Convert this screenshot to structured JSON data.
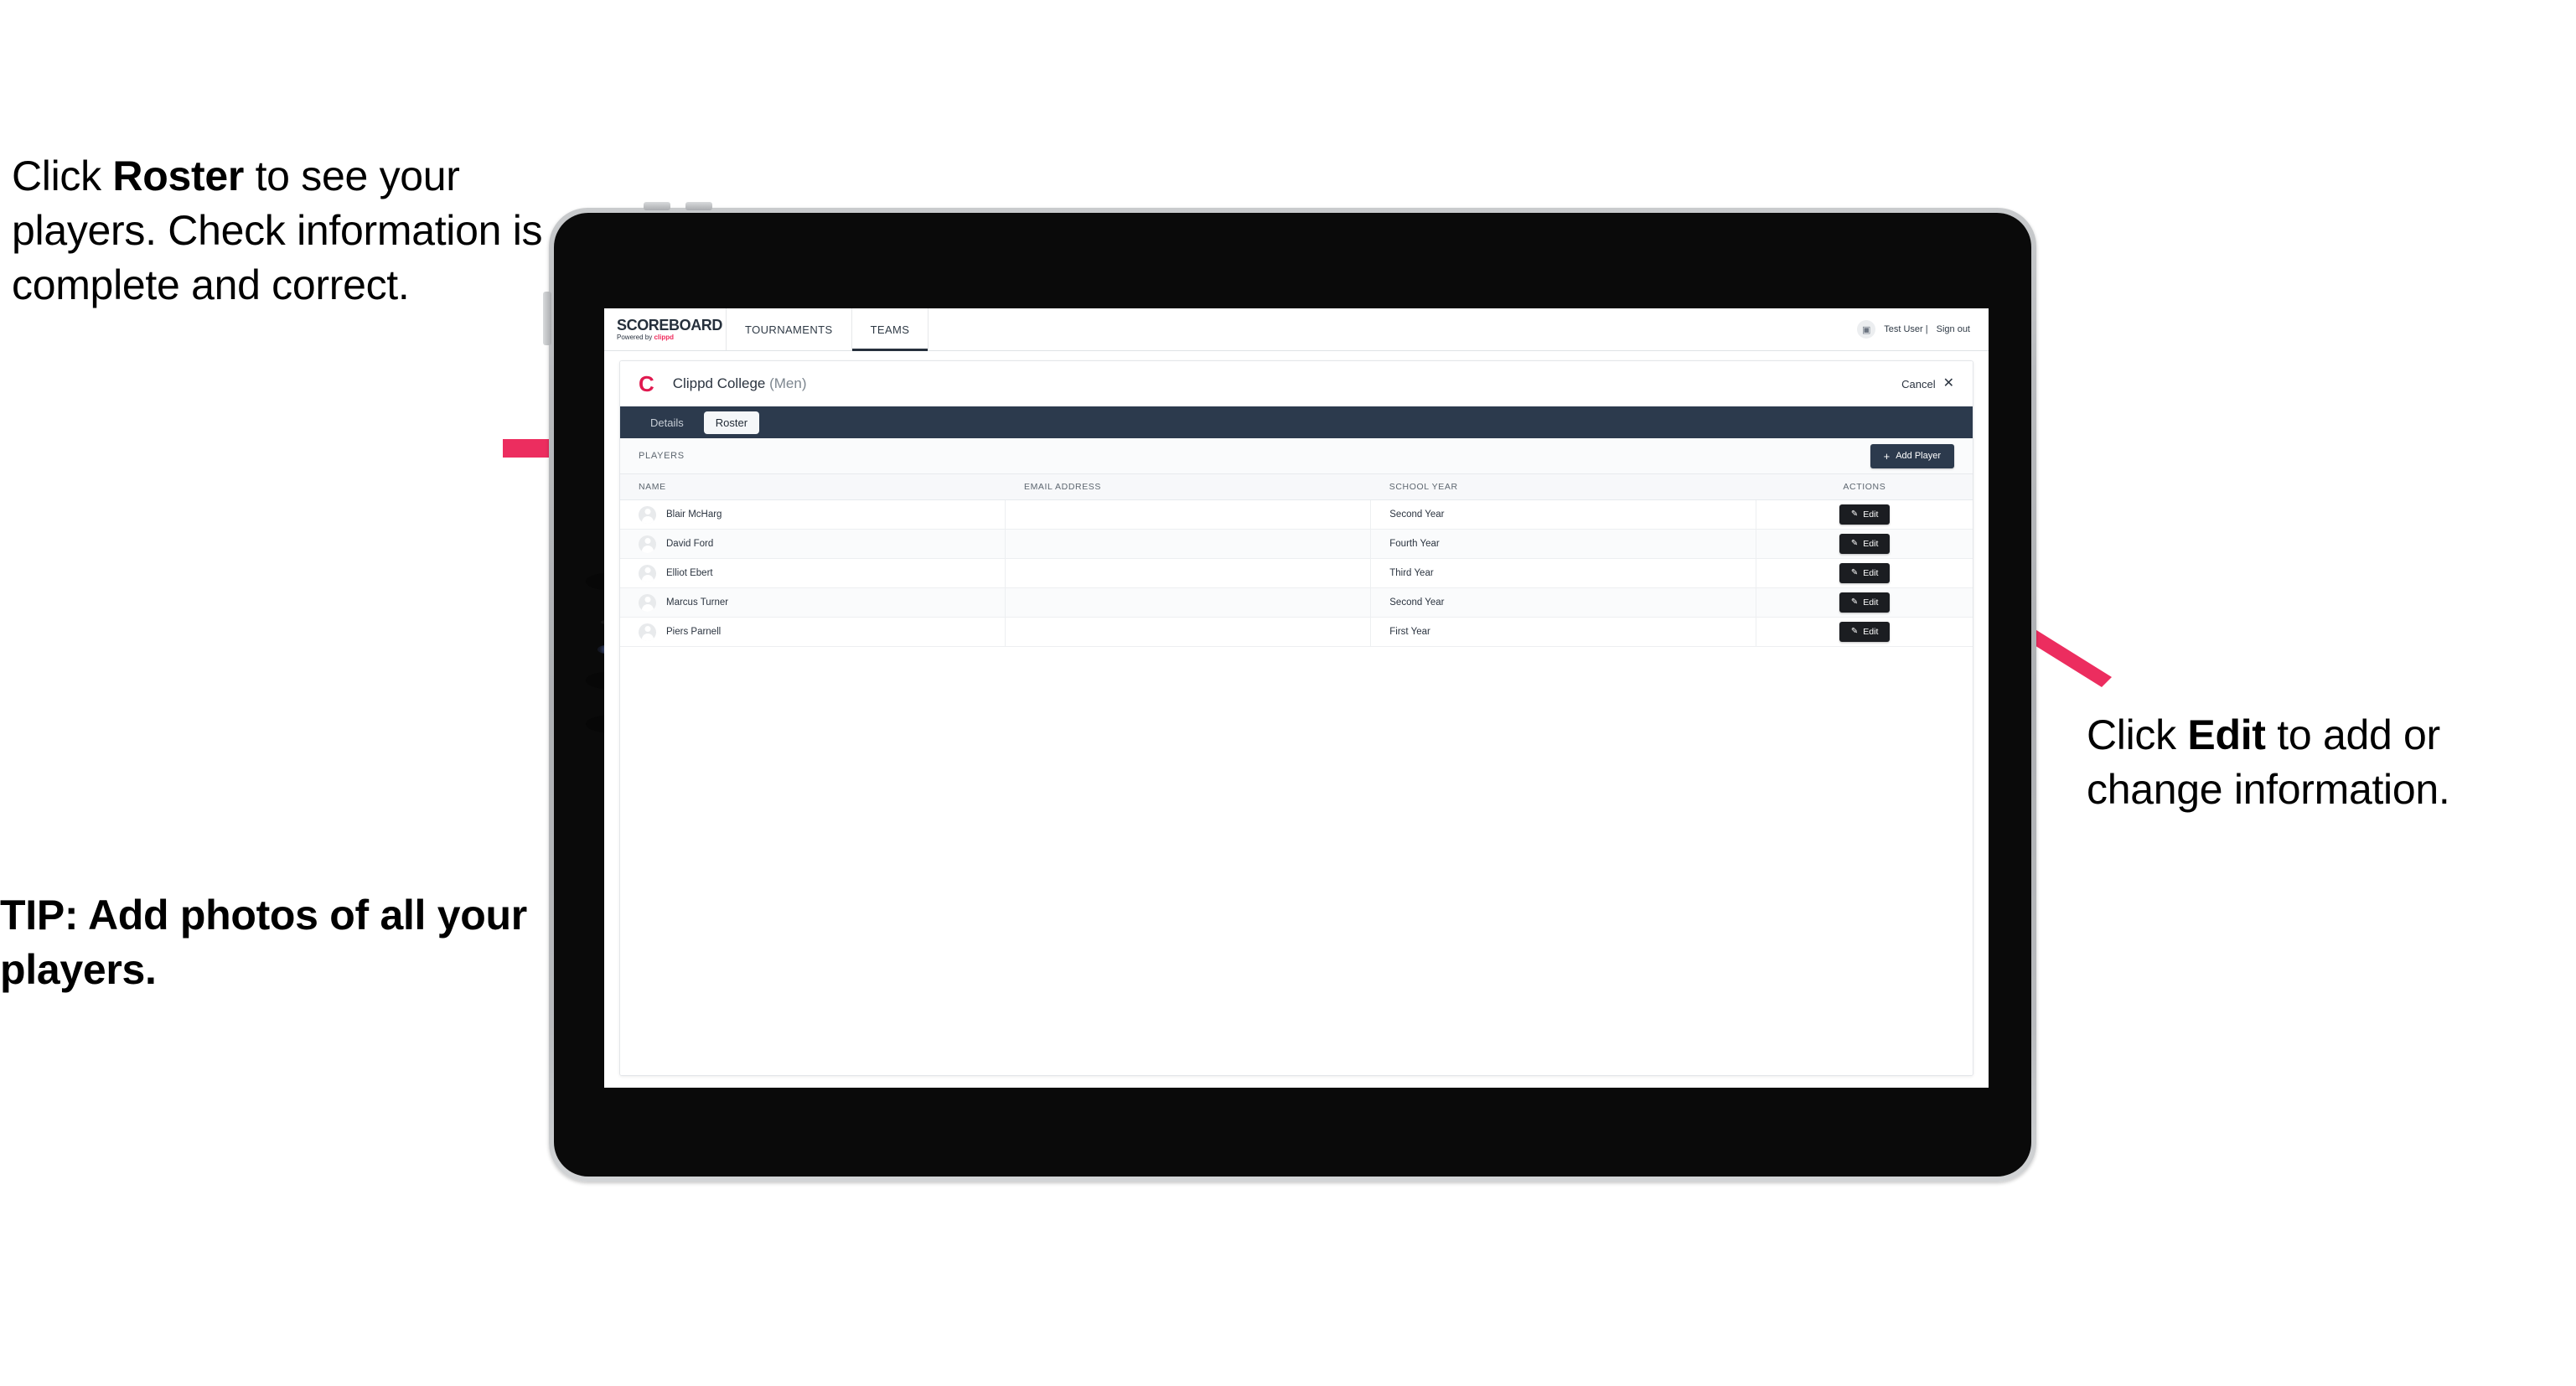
{
  "annotations": {
    "roster_callout": {
      "pre": "Click ",
      "bold": "Roster",
      "post": " to see your players. Check information is complete and correct."
    },
    "tip_callout": "TIP: Add photos of all your players.",
    "edit_callout": {
      "pre": "Click ",
      "bold": "Edit",
      "post": " to add or change information."
    },
    "accent_color": "#ec २d5f"
  },
  "app": {
    "brand": {
      "title": "SCOREBOARD",
      "powered_by": "Powered by ",
      "powered_by_brand": "clippd"
    },
    "topnav": {
      "tabs": [
        {
          "label": "TOURNAMENTS",
          "active": false
        },
        {
          "label": "TEAMS",
          "active": true
        }
      ],
      "user": {
        "avatar_icon": "broken-image-icon",
        "name": "Test User |",
        "sign_out": "Sign out"
      }
    },
    "card": {
      "logo_letter": "C",
      "team_name": "Clippd College",
      "team_gender": "(Men)",
      "cancel_label": "Cancel",
      "cancel_icon": "close-icon",
      "subtabs": [
        {
          "label": "Details",
          "active": false
        },
        {
          "label": "Roster",
          "active": true
        }
      ],
      "players_section_label": "PLAYERS",
      "add_player_label": "Add Player",
      "add_player_icon": "plus-icon",
      "table": {
        "columns": [
          "NAME",
          "EMAIL ADDRESS",
          "SCHOOL YEAR",
          "ACTIONS"
        ],
        "rows": [
          {
            "name": "Blair McHarg",
            "email": "",
            "school_year": "Second Year",
            "action_label": "Edit"
          },
          {
            "name": "David Ford",
            "email": "",
            "school_year": "Fourth Year",
            "action_label": "Edit"
          },
          {
            "name": "Elliot Ebert",
            "email": "",
            "school_year": "Third Year",
            "action_label": "Edit"
          },
          {
            "name": "Marcus Turner",
            "email": "",
            "school_year": "Second Year",
            "action_label": "Edit"
          },
          {
            "name": "Piers Parnell",
            "email": "",
            "school_year": "First Year",
            "action_label": "Edit"
          }
        ]
      }
    }
  }
}
